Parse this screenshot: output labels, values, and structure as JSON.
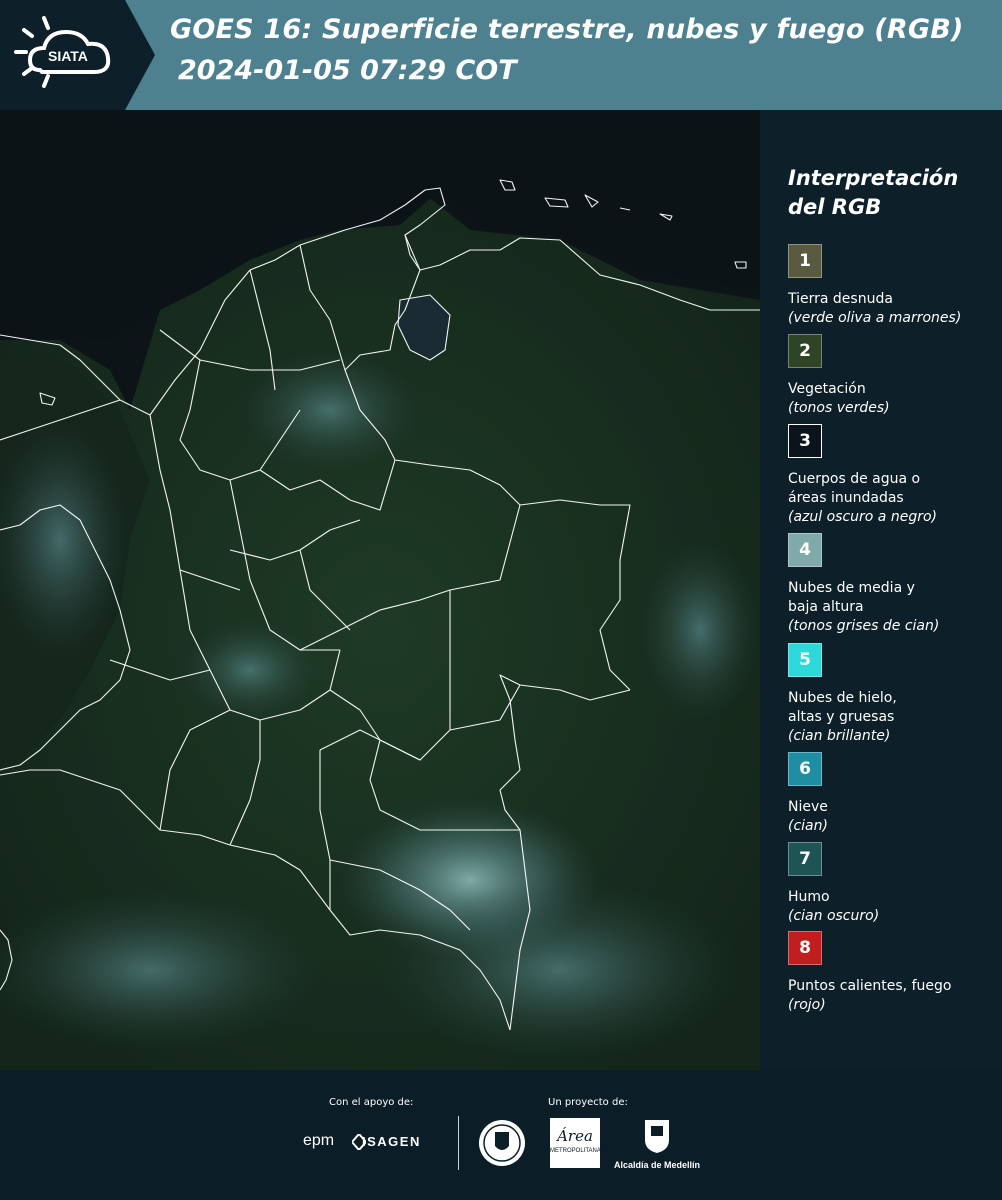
{
  "header": {
    "logo_text": "SIATA",
    "title_line1": "GOES 16: Superficie terrestre, nubes y fuego (RGB)",
    "title_line2": "2024-01-05 07:29 COT"
  },
  "legend": {
    "title": "Interpretación del RGB",
    "items": [
      {
        "number": "1",
        "label": "Tierra desnuda",
        "sub": "(verde oliva a marrones)",
        "color": "#5a5a41"
      },
      {
        "number": "2",
        "label": "Vegetación",
        "sub": "(tonos verdes)",
        "color": "#2f4424"
      },
      {
        "number": "3",
        "label": "Cuerpos de agua o áreas inundadas",
        "sub": "(azul oscuro a negro)",
        "color": "#0b141c"
      },
      {
        "number": "4",
        "label": "Nubes de media y baja altura",
        "sub": "(tonos grises de cian)",
        "color": "#7faaa9"
      },
      {
        "number": "5",
        "label": "Nubes de hielo, altas y gruesas",
        "sub": "(cian brillante)",
        "color": "#2fd8d8"
      },
      {
        "number": "6",
        "label": "Nieve",
        "sub": "(cian)",
        "color": "#1f8ea2"
      },
      {
        "number": "7",
        "label": "Humo",
        "sub": "(cian oscuro)",
        "color": "#1e5454"
      },
      {
        "number": "8",
        "label": "Puntos calientes, fuego",
        "sub": "(rojo)",
        "color": "#c11f1f"
      }
    ]
  },
  "footer": {
    "support_label": "Con el apoyo de:",
    "project_label": "Un proyecto de:",
    "epm": "epm",
    "isagen": "ISAGEN",
    "metro_text": "Área",
    "metro_sub": "METROPOLITANA",
    "alcaldia": "Alcaldía de Medellín"
  },
  "colors": {
    "header_bg": "#4e8190",
    "page_bg": "#0d1f29",
    "border_lines": "#ffffff"
  }
}
